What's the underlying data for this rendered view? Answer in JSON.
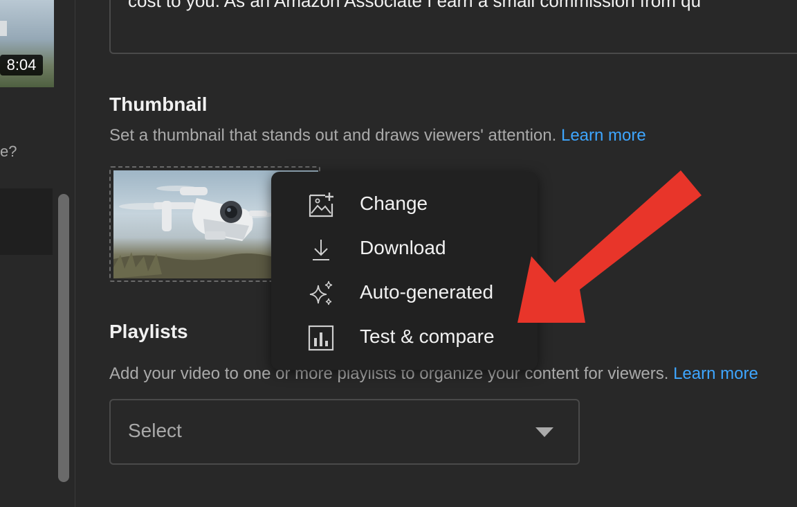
{
  "sidebar": {
    "duration": "8:04",
    "partial_text": "e?"
  },
  "description": {
    "text": "cost to you.  As an Amazon Associate I earn a small commission from qu"
  },
  "thumbnail": {
    "title": "Thumbnail",
    "subtitle": "Set a thumbnail that stands out and draws viewers' attention.",
    "learn_more": "Learn more"
  },
  "menu": {
    "items": [
      {
        "label": "Change",
        "icon": "add-image-icon"
      },
      {
        "label": "Download",
        "icon": "download-icon"
      },
      {
        "label": "Auto-generated",
        "icon": "sparkle-icon"
      },
      {
        "label": "Test & compare",
        "icon": "bar-chart-icon"
      }
    ]
  },
  "playlists": {
    "title": "Playlists",
    "subtitle": "Add your video to one or more playlists to organize your content for viewers.",
    "learn_more": "Learn more",
    "select_value": "Select"
  },
  "colors": {
    "background": "#282828",
    "menu_background": "#212121",
    "link": "#3ea6ff",
    "annotation_arrow": "#e8352a"
  }
}
